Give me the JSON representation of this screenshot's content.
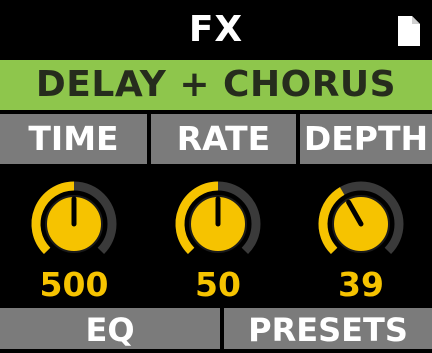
{
  "header": {
    "title": "FX",
    "icon": "document-icon"
  },
  "preset": {
    "name": "DELAY + CHORUS",
    "color": "#8ec64c"
  },
  "params": [
    {
      "label": "TIME",
      "value": "500",
      "level": 0.5
    },
    {
      "label": "RATE",
      "value": "50",
      "level": 0.5
    },
    {
      "label": "DEPTH",
      "value": "39",
      "level": 0.39
    }
  ],
  "knob_color": "#f6c300",
  "bottom_tabs": [
    {
      "label": "EQ"
    },
    {
      "label": "PRESETS"
    }
  ]
}
